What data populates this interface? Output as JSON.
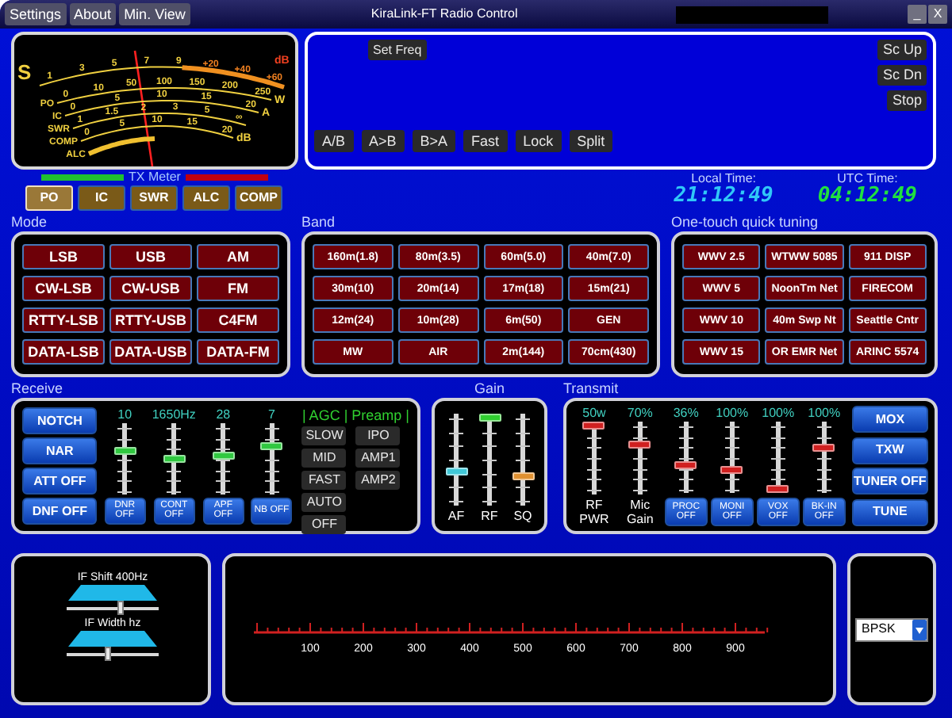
{
  "window": {
    "title": "KiraLink-FT Radio Control"
  },
  "menu": [
    "Settings",
    "About",
    "Min. View"
  ],
  "window_buttons": [
    "_",
    "X"
  ],
  "meter": {
    "scales": [
      {
        "kind": "s",
        "name": "S",
        "unit": "dB",
        "labels": [
          "1",
          "3",
          "5",
          "7",
          "9",
          "+20",
          "+40",
          "+60"
        ]
      },
      {
        "kind": "scale",
        "name": "PO",
        "unit": "W",
        "labels": [
          "0",
          "10",
          "50",
          "100",
          "150",
          "200",
          "250"
        ]
      },
      {
        "kind": "scale",
        "name": "IC",
        "unit": "A",
        "labels": [
          "0",
          "5",
          "10",
          "15",
          "20"
        ]
      },
      {
        "kind": "scale",
        "name": "SWR",
        "labels": [
          "1",
          "1.5",
          "2",
          "3",
          "5",
          "∞"
        ]
      },
      {
        "kind": "scale",
        "name": "COMP",
        "unit": "dB",
        "labels": [
          "0",
          "5",
          "10",
          "15",
          "20"
        ]
      },
      {
        "kind": "bar",
        "name": "ALC"
      }
    ]
  },
  "tx_meter": {
    "label": "TX Meter",
    "buttons": [
      {
        "label": "PO",
        "selected": true
      },
      {
        "label": "IC",
        "selected": false
      },
      {
        "label": "SWR",
        "selected": false
      },
      {
        "label": "ALC",
        "selected": false
      },
      {
        "label": "COMP",
        "selected": false
      }
    ]
  },
  "freq": {
    "set_freq": "Set Freq",
    "buttons": [
      "A/B",
      "A>B",
      "B>A",
      "Fast",
      "Lock",
      "Split"
    ],
    "scan_buttons": [
      "Sc Up",
      "Sc Dn",
      "Stop"
    ]
  },
  "clocks": [
    {
      "label": "Local Time:",
      "time": "21:12:49",
      "color": "#30c8f8"
    },
    {
      "label": "UTC Time:",
      "time": "04:12:49",
      "color": "#20e040"
    }
  ],
  "mode": {
    "title": "Mode",
    "buttons": [
      "LSB",
      "USB",
      "AM",
      "CW-LSB",
      "CW-USB",
      "FM",
      "RTTY-LSB",
      "RTTY-USB",
      "C4FM",
      "DATA-LSB",
      "DATA-USB",
      "DATA-FM"
    ]
  },
  "band": {
    "title": "Band",
    "buttons": [
      "160m(1.8)",
      "80m(3.5)",
      "60m(5.0)",
      "40m(7.0)",
      "30m(10)",
      "20m(14)",
      "17m(18)",
      "15m(21)",
      "12m(24)",
      "10m(28)",
      "6m(50)",
      "GEN",
      "MW",
      "AIR",
      "2m(144)",
      "70cm(430)"
    ]
  },
  "quick_tuning": {
    "title": "One-touch quick tuning",
    "buttons": [
      "WWV 2.5",
      "WTWW 5085",
      "911 DISP",
      "WWV 5",
      "NoonTm Net",
      "FIRECOM",
      "WWV 10",
      "40m Swp Nt",
      "Seattle Cntr",
      "WWV 15",
      "OR EMR Net",
      "ARINC 5574"
    ]
  },
  "receive": {
    "title": "Receive",
    "buttons": [
      "NOTCH",
      "NAR",
      "ATT OFF",
      "DNF OFF"
    ],
    "sliders": [
      {
        "value": "10",
        "level": 0.6,
        "toggle": "DNR OFF"
      },
      {
        "value": "1650Hz",
        "level": 0.48,
        "toggle": "CONT OFF"
      },
      {
        "value": "28",
        "level": 0.52,
        "toggle": "APF OFF"
      },
      {
        "value": "7",
        "level": 0.68,
        "toggle": "NB OFF"
      }
    ],
    "agc_header": "| AGC | Preamp |",
    "agc": [
      "SLOW",
      "MID",
      "FAST",
      "AUTO",
      "OFF"
    ],
    "preamp": [
      "IPO",
      "AMP1",
      "AMP2"
    ]
  },
  "gain": {
    "title": "Gain",
    "sliders": [
      {
        "label": "AF",
        "level": 0.35,
        "color": "#40c8d8"
      },
      {
        "label": "RF",
        "level": 1,
        "color": "#30d030"
      },
      {
        "label": "SQ",
        "level": 0.3,
        "color": "#e09030"
      }
    ]
  },
  "transmit": {
    "title": "Transmit",
    "sliders": [
      {
        "value": "50w",
        "level": 1,
        "kind": "label",
        "label": "RF PWR"
      },
      {
        "value": "70%",
        "level": 0.7,
        "kind": "label",
        "label": "Mic Gain"
      },
      {
        "value": "36%",
        "level": 0.38,
        "kind": "button",
        "label": "PROC OFF"
      },
      {
        "value": "100%",
        "level": 0.3,
        "kind": "button",
        "label": "MONI OFF"
      },
      {
        "value": "100%",
        "level": 0,
        "kind": "button",
        "label": "VOX OFF"
      },
      {
        "value": "100%",
        "level": 0.65,
        "kind": "button",
        "label": "BK-IN OFF"
      }
    ],
    "buttons": [
      "MOX",
      "TXW",
      "TUNER OFF",
      "TUNE"
    ]
  },
  "if_filter": [
    {
      "label": "IF Shift 400Hz",
      "level": 0.6
    },
    {
      "label": "IF Width hz",
      "level": 0.45
    }
  ],
  "spectrum": {
    "scale_labels": [
      "100",
      "200",
      "300",
      "400",
      "500",
      "600",
      "700",
      "800",
      "900"
    ]
  },
  "decoder": {
    "mode": "BPSK"
  }
}
